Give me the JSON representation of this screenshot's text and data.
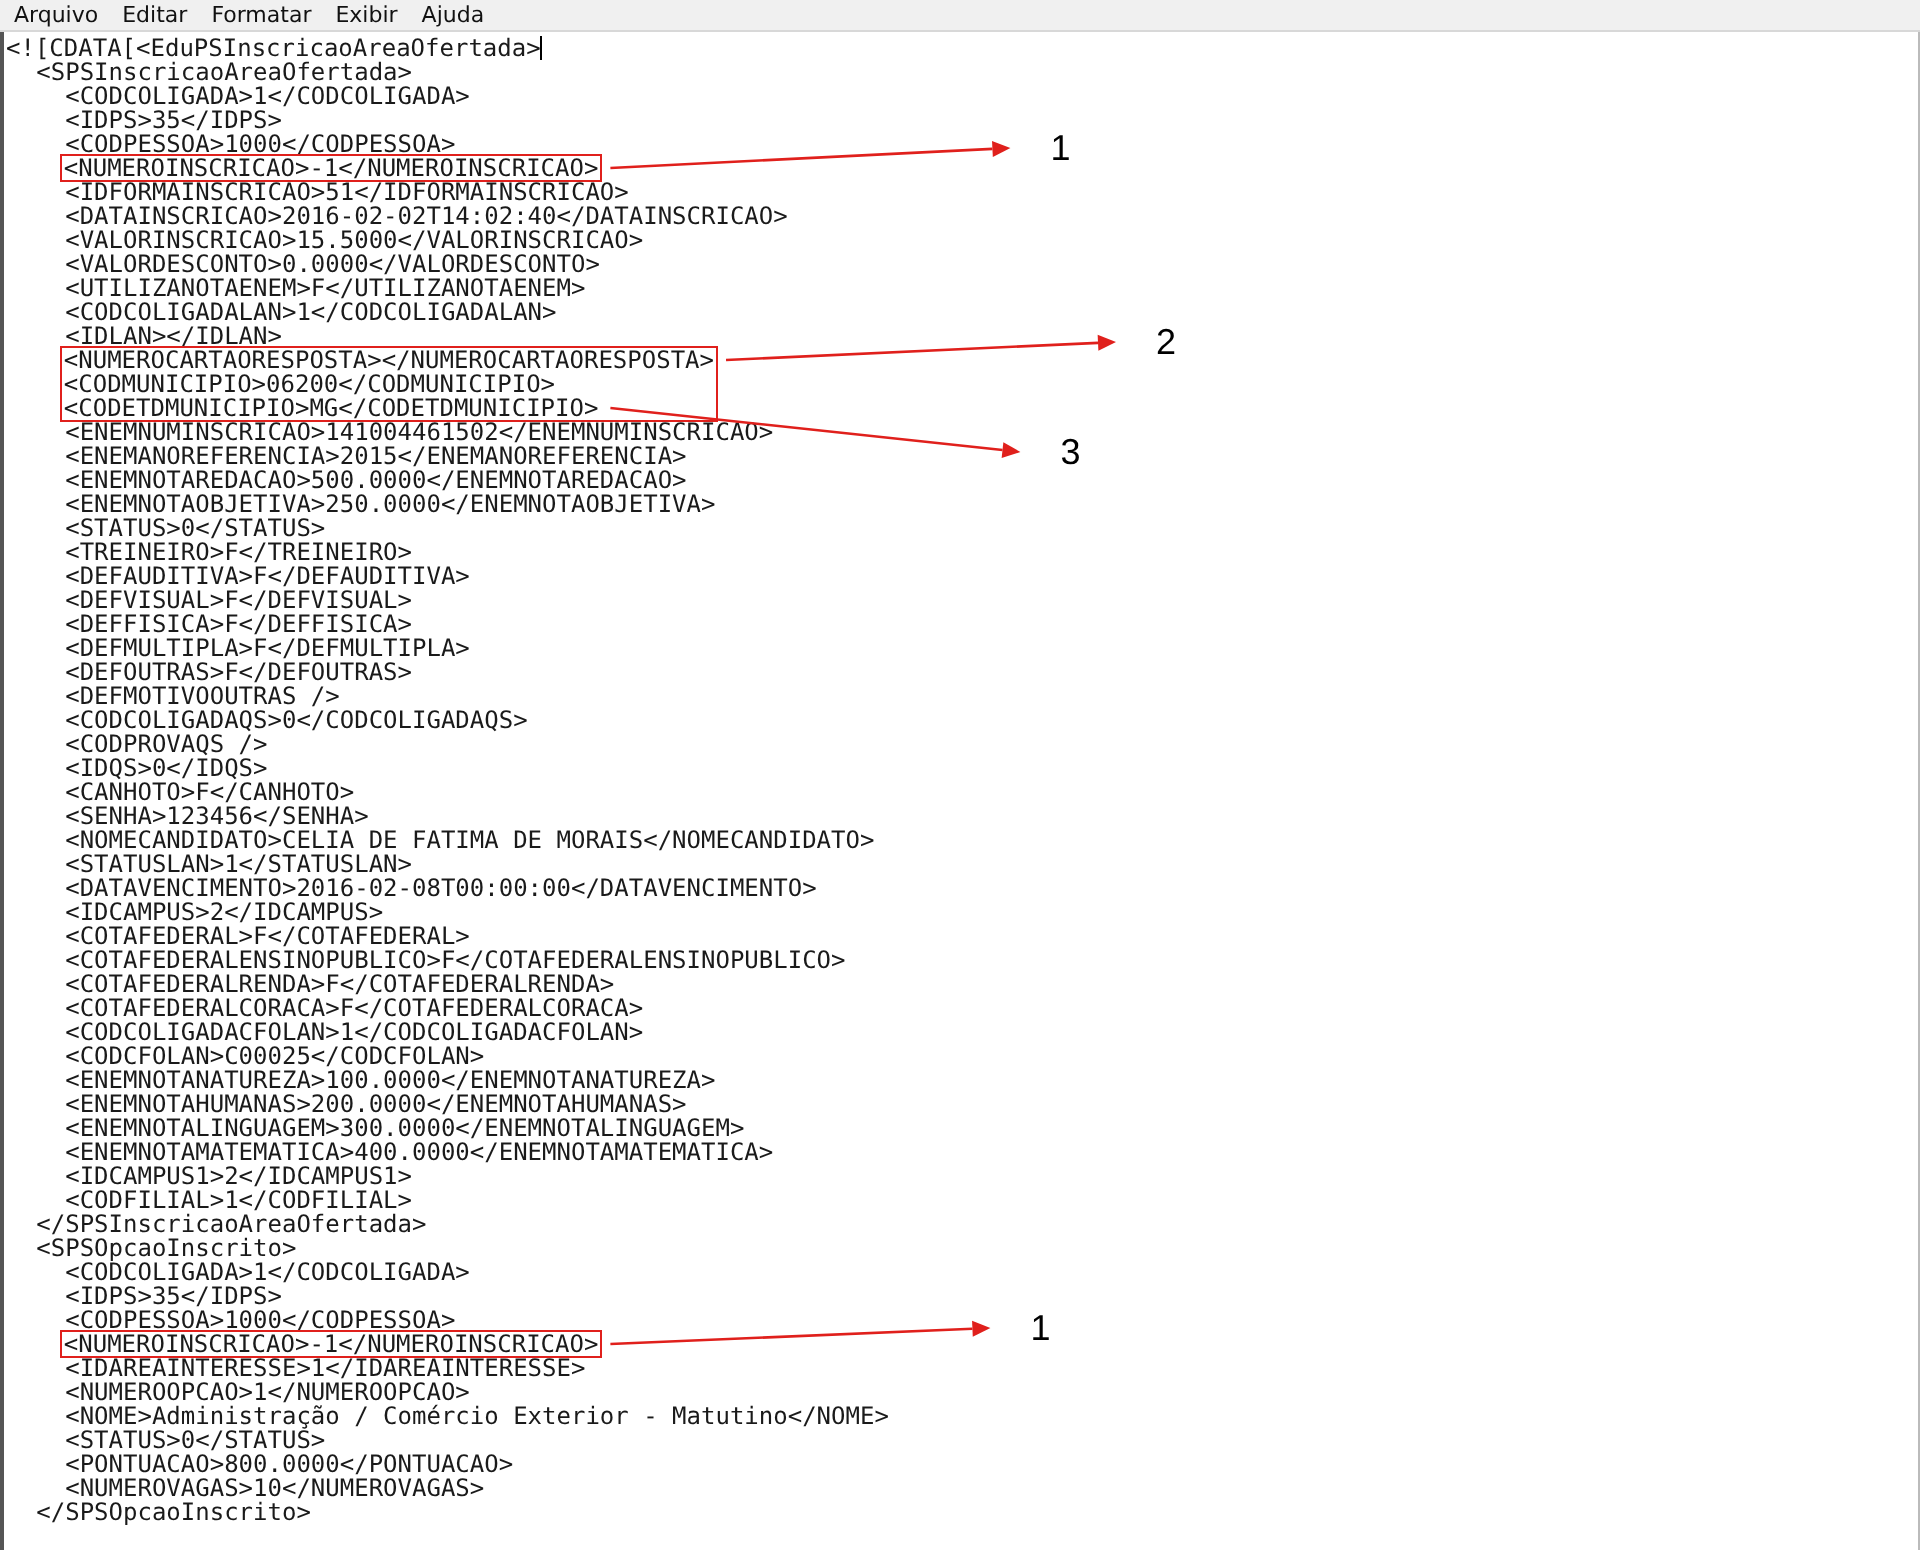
{
  "menu_bar": {
    "items": [
      {
        "label": "Arquivo"
      },
      {
        "label": "Editar"
      },
      {
        "label": "Formatar"
      },
      {
        "label": "Exibir"
      },
      {
        "label": "Ajuda"
      }
    ]
  },
  "document": {
    "lines": [
      {
        "text": "<![CDATA[<EduPSInscricaoAreaOfertada>",
        "cursor": true,
        "children": [
          {
            "text": "<SPSInscricaoAreaOfertada>",
            "children": [
              {
                "text": "<CODCOLIGADA>1</CODCOLIGADA>"
              },
              {
                "text": "<IDPS>35</IDPS>"
              },
              {
                "text": "<CODPESSOA>1000</CODPESSOA>"
              },
              {
                "text": "<NUMEROINSCRICAO>-1</NUMEROINSCRICAO>",
                "highlighted": true,
                "callout": "1"
              },
              {
                "text": "<IDFORMAINSCRICAO>51</IDFORMAINSCRICAO>"
              },
              {
                "text": "<DATAINSCRICAO>2016-02-02T14:02:40</DATAINSCRICAO>"
              },
              {
                "text": "<VALORINSCRICAO>15.5000</VALORINSCRICAO>"
              },
              {
                "text": "<VALORDESCONTO>0.0000</VALORDESCONTO>"
              },
              {
                "text": "<UTILIZANOTAENEM>F</UTILIZANOTAENEM>"
              },
              {
                "text": "<CODCOLIGADALAN>1</CODCOLIGADALAN>"
              },
              {
                "text": "<IDLAN></IDLAN>"
              },
              {
                "text": "<NUMEROCARTAORESPOSTA></NUMEROCARTAORESPOSTA>",
                "highlighted": true,
                "callout": "2"
              },
              {
                "text": "<CODMUNICIPIO>06200</CODMUNICIPIO>",
                "highlighted": true
              },
              {
                "text": "<CODETDMUNICIPIO>MG</CODETDMUNICIPIO>",
                "highlighted": true,
                "callout": "3"
              },
              {
                "text": "<ENEMNUMINSCRICAO>141004461502</ENEMNUMINSCRICAO>"
              },
              {
                "text": "<ENEMANOREFERENCIA>2015</ENEMANOREFERENCIA>"
              },
              {
                "text": "<ENEMNOTAREDACAO>500.0000</ENEMNOTAREDACAO>"
              },
              {
                "text": "<ENEMNOTAOBJETIVA>250.0000</ENEMNOTAOBJETIVA>"
              },
              {
                "text": "<STATUS>0</STATUS>"
              },
              {
                "text": "<TREINEIRO>F</TREINEIRO>"
              },
              {
                "text": "<DEFAUDITIVA>F</DEFAUDITIVA>"
              },
              {
                "text": "<DEFVISUAL>F</DEFVISUAL>"
              },
              {
                "text": "<DEFFISICA>F</DEFFISICA>"
              },
              {
                "text": "<DEFMULTIPLA>F</DEFMULTIPLA>"
              },
              {
                "text": "<DEFOUTRAS>F</DEFOUTRAS>"
              },
              {
                "text": "<DEFMOTIVOOUTRAS />"
              },
              {
                "text": "<CODCOLIGADAQS>0</CODCOLIGADAQS>"
              },
              {
                "text": "<CODPROVAQS />"
              },
              {
                "text": "<IDQS>0</IDQS>"
              },
              {
                "text": "<CANHOTO>F</CANHOTO>"
              },
              {
                "text": "<SENHA>123456</SENHA>"
              },
              {
                "text": "<NOMECANDIDATO>CELIA DE FATIMA DE MORAIS</NOMECANDIDATO>"
              },
              {
                "text": "<STATUSLAN>1</STATUSLAN>"
              },
              {
                "text": "<DATAVENCIMENTO>2016-02-08T00:00:00</DATAVENCIMENTO>"
              },
              {
                "text": "<IDCAMPUS>2</IDCAMPUS>"
              },
              {
                "text": "<COTAFEDERAL>F</COTAFEDERAL>"
              },
              {
                "text": "<COTAFEDERALENSINOPUBLICO>F</COTAFEDERALENSINOPUBLICO>"
              },
              {
                "text": "<COTAFEDERALRENDA>F</COTAFEDERALRENDA>"
              },
              {
                "text": "<COTAFEDERALCORACA>F</COTAFEDERALCORACA>"
              },
              {
                "text": "<CODCOLIGADACFOLAN>1</CODCOLIGADACFOLAN>"
              },
              {
                "text": "<CODCFOLAN>C00025</CODCFOLAN>"
              },
              {
                "text": "<ENEMNOTANATUREZA>100.0000</ENEMNOTANATUREZA>"
              },
              {
                "text": "<ENEMNOTAHUMANAS>200.0000</ENEMNOTAHUMANAS>"
              },
              {
                "text": "<ENEMNOTALINGUAGEM>300.0000</ENEMNOTALINGUAGEM>"
              },
              {
                "text": "<ENEMNOTAMATEMATICA>400.0000</ENEMNOTAMATEMATICA>"
              },
              {
                "text": "<IDCAMPUS1>2</IDCAMPUS1>"
              },
              {
                "text": "<CODFILIAL>1</CODFILIAL>"
              }
            ]
          },
          {
            "text": "</SPSInscricaoAreaOfertada>"
          },
          {
            "text": "<SPSOpcaoInscrito>",
            "children": [
              {
                "text": "<CODCOLIGADA>1</CODCOLIGADA>"
              },
              {
                "text": "<IDPS>35</IDPS>"
              },
              {
                "text": "<CODPESSOA>1000</CODPESSOA>"
              },
              {
                "text": "<NUMEROINSCRICAO>-1</NUMEROINSCRICAO>",
                "highlighted": true,
                "callout": "1"
              },
              {
                "text": "<IDAREAINTERESSE>1</IDAREAINTERESSE>"
              },
              {
                "text": "<NUMEROOPCAO>1</NUMEROOPCAO>"
              },
              {
                "text": "<NOME>Administração / Comércio Exterior - Matutino</NOME>"
              },
              {
                "text": "<STATUS>0</STATUS>"
              },
              {
                "text": "<PONTUACAO>800.0000</PONTUACAO>"
              },
              {
                "text": "<NUMEROVAGAS>10</NUMEROVAGAS>"
              }
            ]
          },
          {
            "text": "</SPSOpcaoInscrito>"
          }
        ]
      }
    ]
  }
}
